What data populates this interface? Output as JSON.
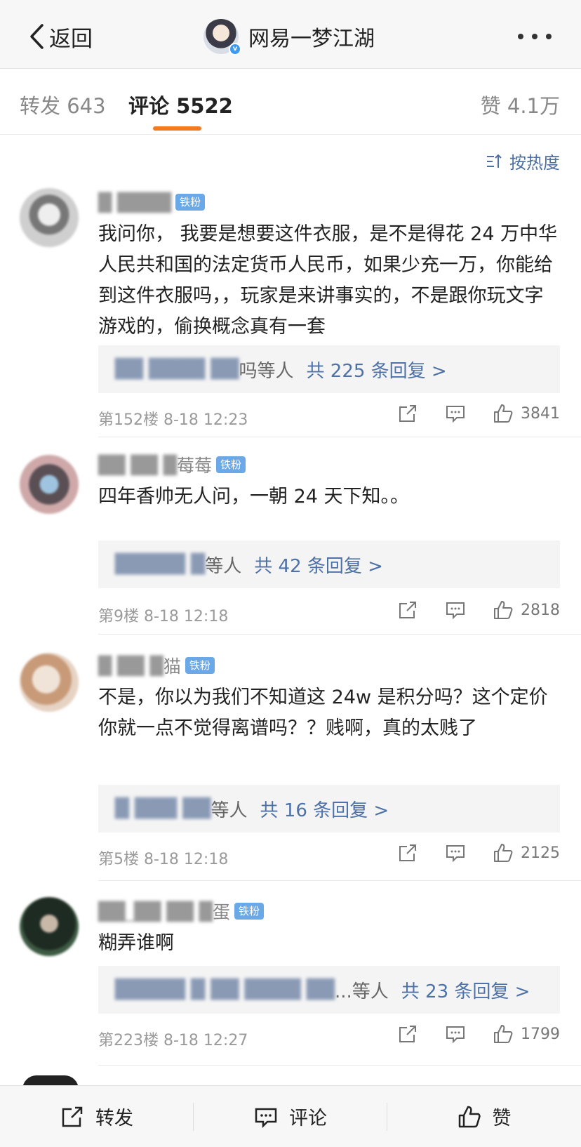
{
  "nav": {
    "back_label": "返回",
    "title": "网易一梦江湖",
    "verified_mark": "v"
  },
  "tabs": {
    "repost": "转发 643",
    "comments": "评论 5522",
    "likes": "赞 4.1万"
  },
  "sort_label": "按热度",
  "colors": {
    "accent": "#f47a20",
    "link": "#4e72a8",
    "badge": "#6aa8e8"
  },
  "comments": [
    {
      "username_hidden": "",
      "badge": "铁粉",
      "text": "我问你， 我要是想要这件衣服，是不是得花 24 万中华人民共和国的法定货币人民币，如果少充一万，你能给到这件衣服吗，，玩家是来讲事实的，不是跟你玩文字游戏的，偷换概念真有一套",
      "reply_users": "",
      "reply_suffix": "吗等人",
      "reply_count": "共 225 条回复 >",
      "floor": "第152楼",
      "time": "8-18 12:23",
      "likes": "3841"
    },
    {
      "username_suffix": "莓莓",
      "badge": "铁粉",
      "text": "四年香帅无人问，一朝 24 天下知。。",
      "reply_suffix": "等人",
      "reply_count": "共 42 条回复 >",
      "floor": "第9楼",
      "time": "8-18 12:18",
      "likes": "2818"
    },
    {
      "username_suffix": "猫",
      "badge": "铁粉",
      "text": "不是，你以为我们不知道这 24w 是积分吗？这个定价你就一点不觉得离谱吗？？贱啊，真的太贱了",
      "reply_suffix": "等人",
      "reply_count": "共 16 条回复 >",
      "floor": "第5楼",
      "time": "8-18 12:18",
      "likes": "2125"
    },
    {
      "username_suffix": "蛋",
      "badge": "铁粉",
      "text": "糊弄谁啊",
      "reply_suffix": "...等人",
      "reply_count": "共 23 条回复 >",
      "floor": "第223楼",
      "time": "8-18 12:27",
      "likes": "1799"
    }
  ],
  "bottom": {
    "repost": "转发",
    "comment": "评论",
    "like": "赞"
  }
}
